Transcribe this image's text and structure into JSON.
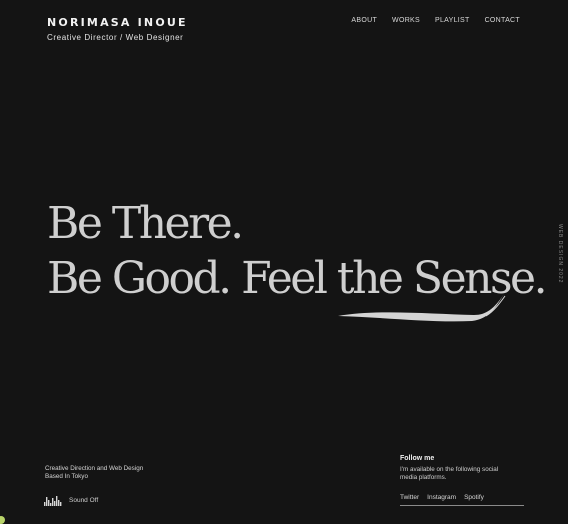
{
  "header": {
    "name": "NORIMASA INOUE",
    "role": "Creative Director / Web Designer"
  },
  "nav": {
    "items": [
      {
        "label": "ABOUT"
      },
      {
        "label": "WORKS"
      },
      {
        "label": "PLAYLIST"
      },
      {
        "label": "CONTACT"
      }
    ]
  },
  "hero": {
    "line1": "Be There.",
    "line2": "Be Good. Feel the Sense."
  },
  "side_text": "WEB DESIGN 2022",
  "footer": {
    "tagline_1": "Creative Direction and Web Design",
    "tagline_2": "Based In Tokyo",
    "sound_label": "Sound Off",
    "follow_title": "Follow me",
    "follow_desc": "I'm available on the following social media platforms.",
    "socials": [
      {
        "label": "Twitter"
      },
      {
        "label": "Instagram"
      },
      {
        "label": "Spotify"
      }
    ]
  },
  "colors": {
    "background": "#141414",
    "text": "#e9e9e9",
    "cursor_accent": "#b9d46a"
  }
}
